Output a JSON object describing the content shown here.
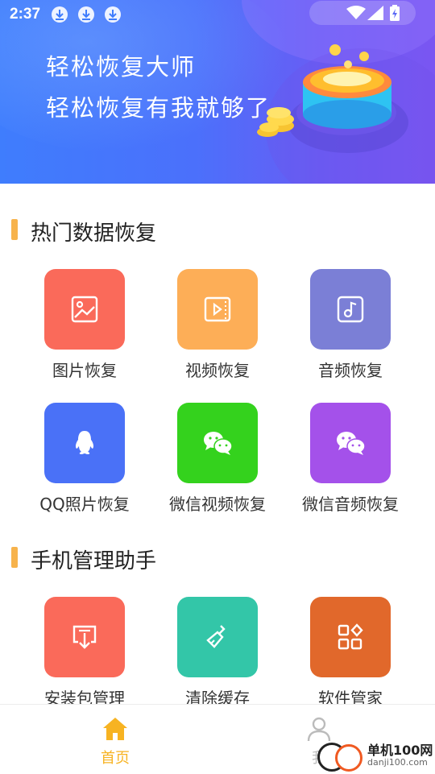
{
  "status_bar": {
    "time": "2:37"
  },
  "banner": {
    "line1": "轻松恢复大师",
    "line2": "轻松恢复有我就够了"
  },
  "sections": [
    {
      "title": "热门数据恢复"
    },
    {
      "title": "手机管理助手"
    }
  ],
  "tiles": [
    {
      "label": "图片恢复",
      "icon": "image-icon",
      "color": "#fa6a5a"
    },
    {
      "label": "视频恢复",
      "icon": "video-icon",
      "color": "#fdae57"
    },
    {
      "label": "音频恢复",
      "icon": "music-icon",
      "color": "#7b7fd6"
    },
    {
      "label": "QQ照片恢复",
      "icon": "qq-icon",
      "color": "#4a71f7"
    },
    {
      "label": "微信视频恢复",
      "icon": "wechat-icon",
      "color": "#34d21d"
    },
    {
      "label": "微信音频恢复",
      "icon": "wechat-icon",
      "color": "#a451ea"
    },
    {
      "label": "安装包管理",
      "icon": "package-icon",
      "color": "#fa6a5a"
    },
    {
      "label": "清除缓存",
      "icon": "broom-icon",
      "color": "#33c6a8"
    },
    {
      "label": "软件管家",
      "icon": "apps-icon",
      "color": "#e1682b"
    }
  ],
  "tab_bar": {
    "home_label": "首页",
    "mine_label": "我",
    "active_color": "#f7b322",
    "inactive_color": "#bbbbbb"
  },
  "watermark": {
    "title": "单机100网",
    "url": "danji100.com"
  }
}
